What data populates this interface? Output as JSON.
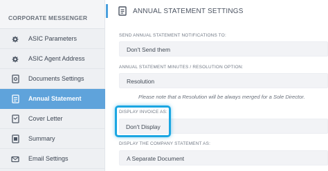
{
  "sidebar": {
    "title": "CORPORATE MESSENGER",
    "items": [
      {
        "label": "ASIC Parameters",
        "icon": "gear-icon",
        "active": false
      },
      {
        "label": "ASIC Agent Address",
        "icon": "gear-icon",
        "active": false
      },
      {
        "label": "Documents Settings",
        "icon": "document-settings-icon",
        "active": false
      },
      {
        "label": "Annual Statement",
        "icon": "document-icon",
        "active": true
      },
      {
        "label": "Cover Letter",
        "icon": "cover-letter-icon",
        "active": false
      },
      {
        "label": "Summary",
        "icon": "summary-icon",
        "active": false
      },
      {
        "label": "Email Settings",
        "icon": "email-icon",
        "active": false
      }
    ]
  },
  "header": {
    "title": "ANNUAL STATEMENT SETTINGS",
    "icon": "document-icon"
  },
  "fields": [
    {
      "label": "SEND ANNUAL STATEMENT NOTIFICATIONS TO:",
      "value": "Don't Send them"
    },
    {
      "label": "ANNUAL STATEMENT MINUTES / RESOLUTION OPTION:",
      "value": "Resolution"
    },
    {
      "label": "DISPLAY INVOICE AS:",
      "value": "Don't Display"
    },
    {
      "label": "DISPLAY THE COMPANY STATEMENT AS:",
      "value": "A Separate Document"
    }
  ],
  "note": "Please note that a Resolution will be always merged for a Sole Director.",
  "colors": {
    "accent": "#5fa3db",
    "highlight": "#1aa6e2",
    "sidebar_bg": "#eef0f3"
  }
}
